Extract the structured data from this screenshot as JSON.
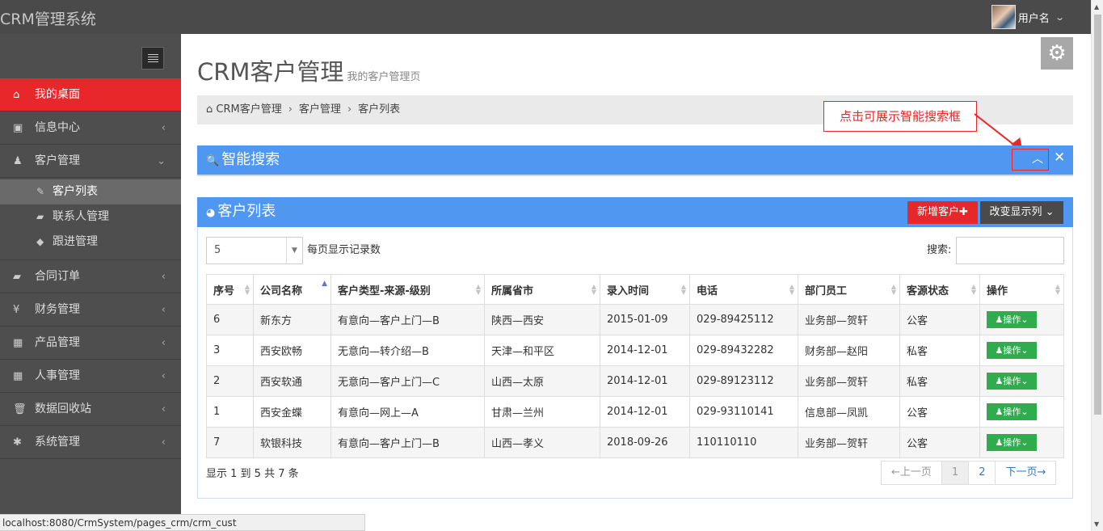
{
  "app": {
    "brand": "CRM管理系统",
    "user_name": "用户名"
  },
  "sidebar": {
    "items": [
      {
        "icon": "home-icon",
        "glyph": "⌂",
        "label": "我的桌面"
      },
      {
        "icon": "image-icon",
        "glyph": "▣",
        "label": "信息中心"
      },
      {
        "icon": "user-icon",
        "glyph": "♟",
        "label": "客户管理"
      },
      {
        "icon": "book-icon",
        "glyph": "▰",
        "label": "合同订单"
      },
      {
        "icon": "yen-icon",
        "glyph": "¥",
        "label": "财务管理"
      },
      {
        "icon": "grid-icon",
        "glyph": "▦",
        "label": "产品管理"
      },
      {
        "icon": "grid-icon",
        "glyph": "▦",
        "label": "人事管理"
      },
      {
        "icon": "trash-icon",
        "glyph": "🗑",
        "label": "数据回收站"
      },
      {
        "icon": "gear-icon",
        "glyph": "✱",
        "label": "系统管理"
      }
    ],
    "sub_items": [
      {
        "icon": "edit-icon",
        "glyph": "✎",
        "label": "客户列表"
      },
      {
        "icon": "book-icon",
        "glyph": "▰",
        "label": "联系人管理"
      },
      {
        "icon": "tag-icon",
        "glyph": "◆",
        "label": "跟进管理"
      }
    ]
  },
  "page": {
    "title": "CRM客户管理",
    "subtitle": "我的客户管理页"
  },
  "breadcrumb": [
    "CRM客户管理",
    "客户管理",
    "客户列表"
  ],
  "callout": "点击可展示智能搜索框",
  "search_box": {
    "title": "智能搜索"
  },
  "list_box": {
    "title": "客户列表",
    "add_button": "新增客户",
    "columns_button": "改变显示列",
    "page_length": "5",
    "page_length_label": "每页显示记录数",
    "search_label": "搜索:",
    "search_value": "",
    "info": "显示 1 到 5 共 7 条",
    "pager": {
      "prev": "←上一页",
      "pages": [
        "1",
        "2"
      ],
      "next": "下一页→"
    }
  },
  "table": {
    "headers": [
      "序号",
      "公司名称",
      "客户类型-来源-级别",
      "所属省市",
      "录入时间",
      "电话",
      "部门员工",
      "客源状态",
      "操作"
    ],
    "op_label": "操作",
    "rows": [
      [
        "6",
        "新东方",
        "有意向—客户上门—B",
        "陕西—西安",
        "2015-01-09",
        "029-89425112",
        "业务部—贺轩",
        "公客"
      ],
      [
        "3",
        "西安欧畅",
        "无意向—转介绍—B",
        "天津—和平区",
        "2014-12-01",
        "029-89432282",
        "财务部—赵阳",
        "私客"
      ],
      [
        "2",
        "西安软通",
        "无意向—客户上门—C",
        "山西—太原",
        "2014-12-01",
        "029-89123112",
        "业务部—贺轩",
        "私客"
      ],
      [
        "1",
        "西安金蝶",
        "有意向—网上—A",
        "甘肃—兰州",
        "2014-12-01",
        "029-93110141",
        "信息部—凤凯",
        "公客"
      ],
      [
        "7",
        "软银科技",
        "有意向—客户上门—B",
        "山西—孝义",
        "2018-09-26",
        "110110110",
        "业务部—贺轩",
        "公客"
      ]
    ]
  },
  "status_url": "localhost:8080/CrmSystem/pages_crm/crm_cust",
  "colors": {
    "accent_red": "#e8272b",
    "header_blue": "#4f97f0",
    "op_green": "#2fad4e",
    "dark": "#4a4a4a"
  }
}
